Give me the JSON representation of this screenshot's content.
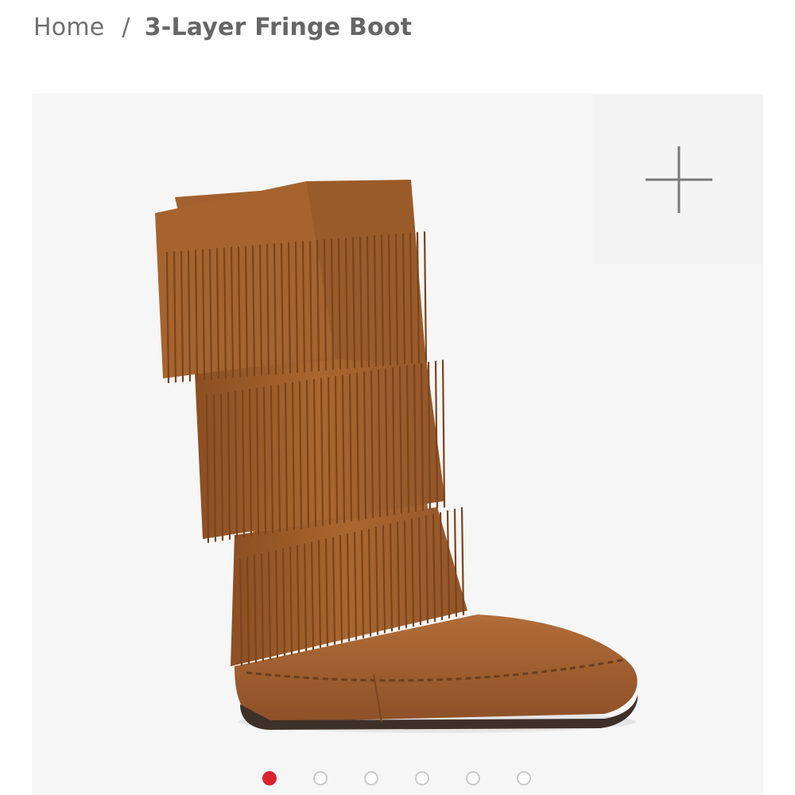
{
  "breadcrumb": {
    "home_label": "Home",
    "separator": "/",
    "current_label": "3-Layer Fringe Boot"
  },
  "gallery": {
    "zoom_icon": "plus-icon",
    "image_icon": "fringe-boot-product-image",
    "slide_count": 6,
    "active_slide": 1,
    "colors": {
      "active_dot": "#d9232e",
      "inactive_dot_border": "#c9c9c9",
      "suede": "#9a5a2a",
      "background": "#f6f6f6"
    }
  }
}
